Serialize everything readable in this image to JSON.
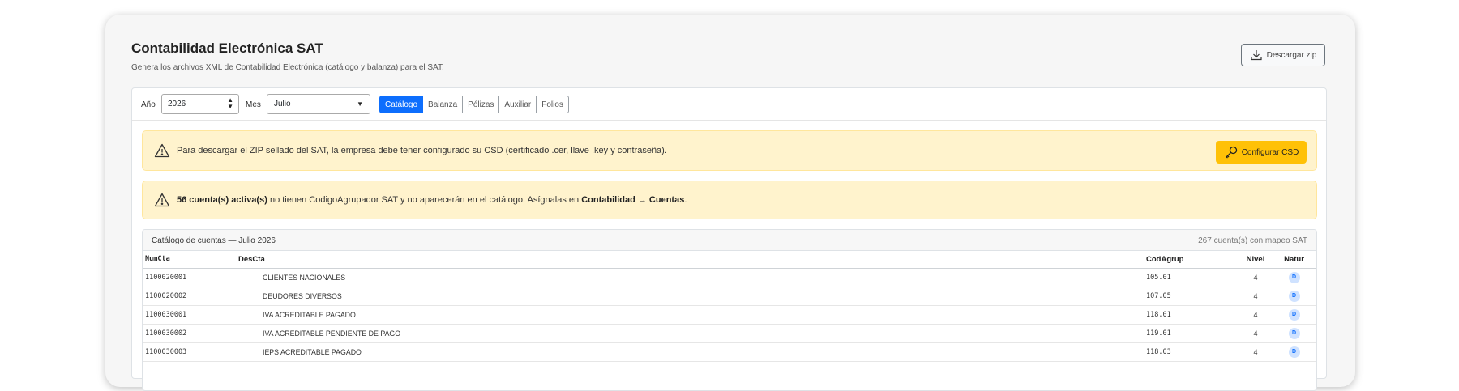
{
  "header": {
    "title": "Contabilidad Electrónica SAT",
    "subtitle": "Genera los archivos XML de Contabilidad Electrónica (catálogo y balanza) para el SAT.",
    "download_label": "Descargar zip"
  },
  "filters": {
    "year_label": "Año",
    "year_value": "2026",
    "month_label": "Mes",
    "month_value": "Julio"
  },
  "tabs": [
    {
      "label": "Catálogo",
      "active": true
    },
    {
      "label": "Balanza",
      "active": false
    },
    {
      "label": "Pólizas",
      "active": false
    },
    {
      "label": "Auxiliar",
      "active": false
    },
    {
      "label": "Folios",
      "active": false
    }
  ],
  "alerts": {
    "csd_text": "Para descargar el ZIP sellado del SAT, la empresa debe tener configurado su CSD (certificado .cer, llave .key y contraseña).",
    "csd_button": "Configurar CSD",
    "accounts_bold": "56 cuenta(s) activa(s)",
    "accounts_text": " no tienen CodigoAgrupador SAT y no aparecerán en el catálogo. Asígnalas en ",
    "accounts_path": "Contabilidad → Cuentas",
    "accounts_end": "."
  },
  "catalog": {
    "title": "Catálogo de cuentas — Julio 2026",
    "count": "267 cuenta(s) con mapeo SAT",
    "columns": {
      "num": "NumCta",
      "desc": "DesCta",
      "cod": "CodAgrup",
      "nivel": "Nivel",
      "natur": "Natur"
    },
    "rows": [
      {
        "num": "1100020001",
        "desc": "CLIENTES NACIONALES",
        "cod": "105.01",
        "nivel": "4",
        "natur": "D"
      },
      {
        "num": "1100020002",
        "desc": "DEUDORES DIVERSOS",
        "cod": "107.05",
        "nivel": "4",
        "natur": "D"
      },
      {
        "num": "1100030001",
        "desc": "IVA ACREDITABLE PAGADO",
        "cod": "118.01",
        "nivel": "4",
        "natur": "D"
      },
      {
        "num": "1100030002",
        "desc": "IVA ACREDITABLE PENDIENTE DE PAGO",
        "cod": "119.01",
        "nivel": "4",
        "natur": "D"
      },
      {
        "num": "1100030003",
        "desc": "IEPS ACREDITABLE PAGADO",
        "cod": "118.03",
        "nivel": "4",
        "natur": "D"
      }
    ]
  },
  "colors": {
    "primary": "#0d6efd",
    "warning_bg": "#fff3cd",
    "warning_btn": "#ffc107"
  }
}
